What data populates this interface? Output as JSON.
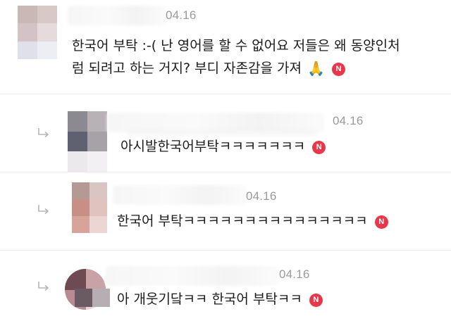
{
  "comments": [
    {
      "date": "04.16",
      "text_line1": "한국어 부탁 :-( 난 영어를 할 수 없어요 저들은 왜 동양인처",
      "text_line2": "럼 되려고 하는 거지? 부디 자존감을 가져",
      "emoji": "🙏",
      "badge": "N"
    },
    {
      "date": "04.16",
      "text": "아시발한국어부탁ㅋㅋㅋㅋㅋㅋㅋ",
      "badge": "N"
    },
    {
      "date": "04.16",
      "text": "한국어 부탁ㅋㅋㅋㅋㅋㅋㅋㅋㅋㅋㅋㅋㅋㅋㅋ",
      "badge": "N"
    },
    {
      "date": "04.16",
      "text": "아 개웃기닼ㅋㅋ 한국어 부탁ㅋㅋ",
      "badge": "N"
    }
  ],
  "colors": {
    "badge": "#e8364a",
    "date": "#9a9a9a",
    "divider": "#ececec"
  },
  "icons": {
    "reply": "reply-arrow-icon",
    "badge": "new-badge-icon"
  }
}
